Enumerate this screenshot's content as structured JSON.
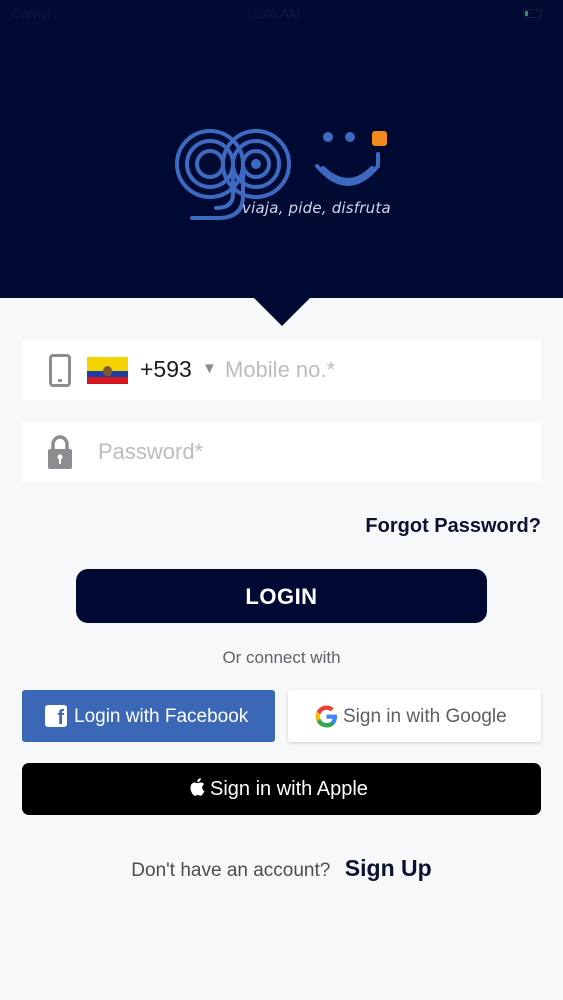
{
  "status_bar": {
    "carrier": "Carrier",
    "time": "11:48 AM"
  },
  "brand": {
    "logo_text": "gou",
    "tagline": "viaja, pide, disfruta"
  },
  "login_form": {
    "country_code": "+593",
    "mobile_placeholder": "Mobile no.*",
    "password_placeholder": "Password*",
    "forgot_password": "Forgot Password?",
    "login_button": "LOGIN"
  },
  "social": {
    "divider_text": "Or connect with",
    "facebook_label": "Login with Facebook",
    "google_label": "Sign in with Google",
    "apple_label": "Sign in with Apple"
  },
  "signup": {
    "question": "Don't have an account?",
    "link": "Sign Up"
  },
  "colors": {
    "navy": "#010a33",
    "facebook": "#3b67b7",
    "accent_orange": "#f08a1c",
    "logo_blue": "#3d6ac0"
  },
  "icons": [
    "phone-icon",
    "ecuador-flag-icon",
    "lock-icon",
    "facebook-icon",
    "google-icon",
    "apple-icon"
  ]
}
